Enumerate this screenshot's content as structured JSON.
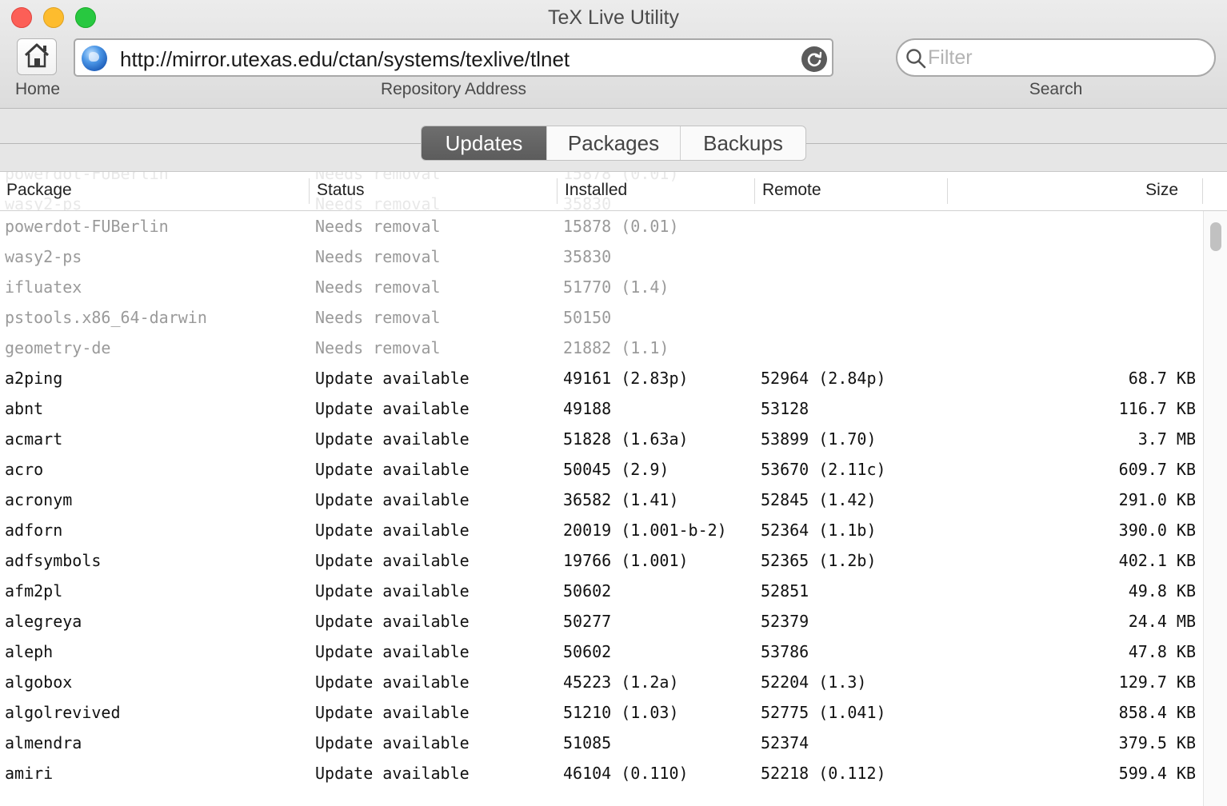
{
  "window": {
    "title": "TeX Live Utility"
  },
  "toolbar": {
    "home_label": "Home",
    "url_value": "http://mirror.utexas.edu/ctan/systems/texlive/tlnet",
    "repo_label": "Repository Address",
    "search_placeholder": "Filter",
    "search_label": "Search"
  },
  "tabs": [
    {
      "label": "Updates",
      "active": true
    },
    {
      "label": "Packages",
      "active": false
    },
    {
      "label": "Backups",
      "active": false
    }
  ],
  "table": {
    "columns": {
      "package": "Package",
      "status": "Status",
      "installed": "Installed",
      "remote": "Remote",
      "size": "Size"
    },
    "rows": [
      {
        "package": "powerdot-FUBerlin",
        "status": "Needs removal",
        "installed": "15878 (0.01)",
        "remote": "",
        "size": "",
        "muted": true
      },
      {
        "package": "wasy2-ps",
        "status": "Needs removal",
        "installed": "35830",
        "remote": "",
        "size": "",
        "muted": true
      },
      {
        "package": "ifluatex",
        "status": "Needs removal",
        "installed": "51770 (1.4)",
        "remote": "",
        "size": "",
        "muted": true
      },
      {
        "package": "pstools.x86_64-darwin",
        "status": "Needs removal",
        "installed": "50150",
        "remote": "",
        "size": "",
        "muted": true
      },
      {
        "package": "geometry-de",
        "status": "Needs removal",
        "installed": "21882 (1.1)",
        "remote": "",
        "size": "",
        "muted": true
      },
      {
        "package": "a2ping",
        "status": "Update available",
        "installed": "49161 (2.83p)",
        "remote": "52964 (2.84p)",
        "size": "68.7 KB",
        "muted": false
      },
      {
        "package": "abnt",
        "status": "Update available",
        "installed": "49188",
        "remote": "53128",
        "size": "116.7 KB",
        "muted": false
      },
      {
        "package": "acmart",
        "status": "Update available",
        "installed": "51828 (1.63a)",
        "remote": "53899 (1.70)",
        "size": "3.7 MB",
        "muted": false
      },
      {
        "package": "acro",
        "status": "Update available",
        "installed": "50045 (2.9)",
        "remote": "53670 (2.11c)",
        "size": "609.7 KB",
        "muted": false
      },
      {
        "package": "acronym",
        "status": "Update available",
        "installed": "36582 (1.41)",
        "remote": "52845 (1.42)",
        "size": "291.0 KB",
        "muted": false
      },
      {
        "package": "adforn",
        "status": "Update available",
        "installed": "20019 (1.001-b-2)",
        "remote": "52364 (1.1b)",
        "size": "390.0 KB",
        "muted": false
      },
      {
        "package": "adfsymbols",
        "status": "Update available",
        "installed": "19766 (1.001)",
        "remote": "52365 (1.2b)",
        "size": "402.1 KB",
        "muted": false
      },
      {
        "package": "afm2pl",
        "status": "Update available",
        "installed": "50602",
        "remote": "52851",
        "size": "49.8 KB",
        "muted": false
      },
      {
        "package": "alegreya",
        "status": "Update available",
        "installed": "50277",
        "remote": "52379",
        "size": "24.4 MB",
        "muted": false
      },
      {
        "package": "aleph",
        "status": "Update available",
        "installed": "50602",
        "remote": "53786",
        "size": "47.8 KB",
        "muted": false
      },
      {
        "package": "algobox",
        "status": "Update available",
        "installed": "45223 (1.2a)",
        "remote": "52204 (1.3)",
        "size": "129.7 KB",
        "muted": false
      },
      {
        "package": "algolrevived",
        "status": "Update available",
        "installed": "51210 (1.03)",
        "remote": "52775 (1.041)",
        "size": "858.4 KB",
        "muted": false
      },
      {
        "package": "almendra",
        "status": "Update available",
        "installed": "51085",
        "remote": "52374",
        "size": "379.5 KB",
        "muted": false
      },
      {
        "package": "amiri",
        "status": "Update available",
        "installed": "46104 (0.110)",
        "remote": "52218 (0.112)",
        "size": "599.4 KB",
        "muted": false
      }
    ]
  },
  "colors": {
    "muted_text": "#9a9a9a",
    "active_tab": "#5c5c5c",
    "close": "#fc5f57",
    "minimize": "#fdbc2e",
    "maximize": "#28c840"
  }
}
